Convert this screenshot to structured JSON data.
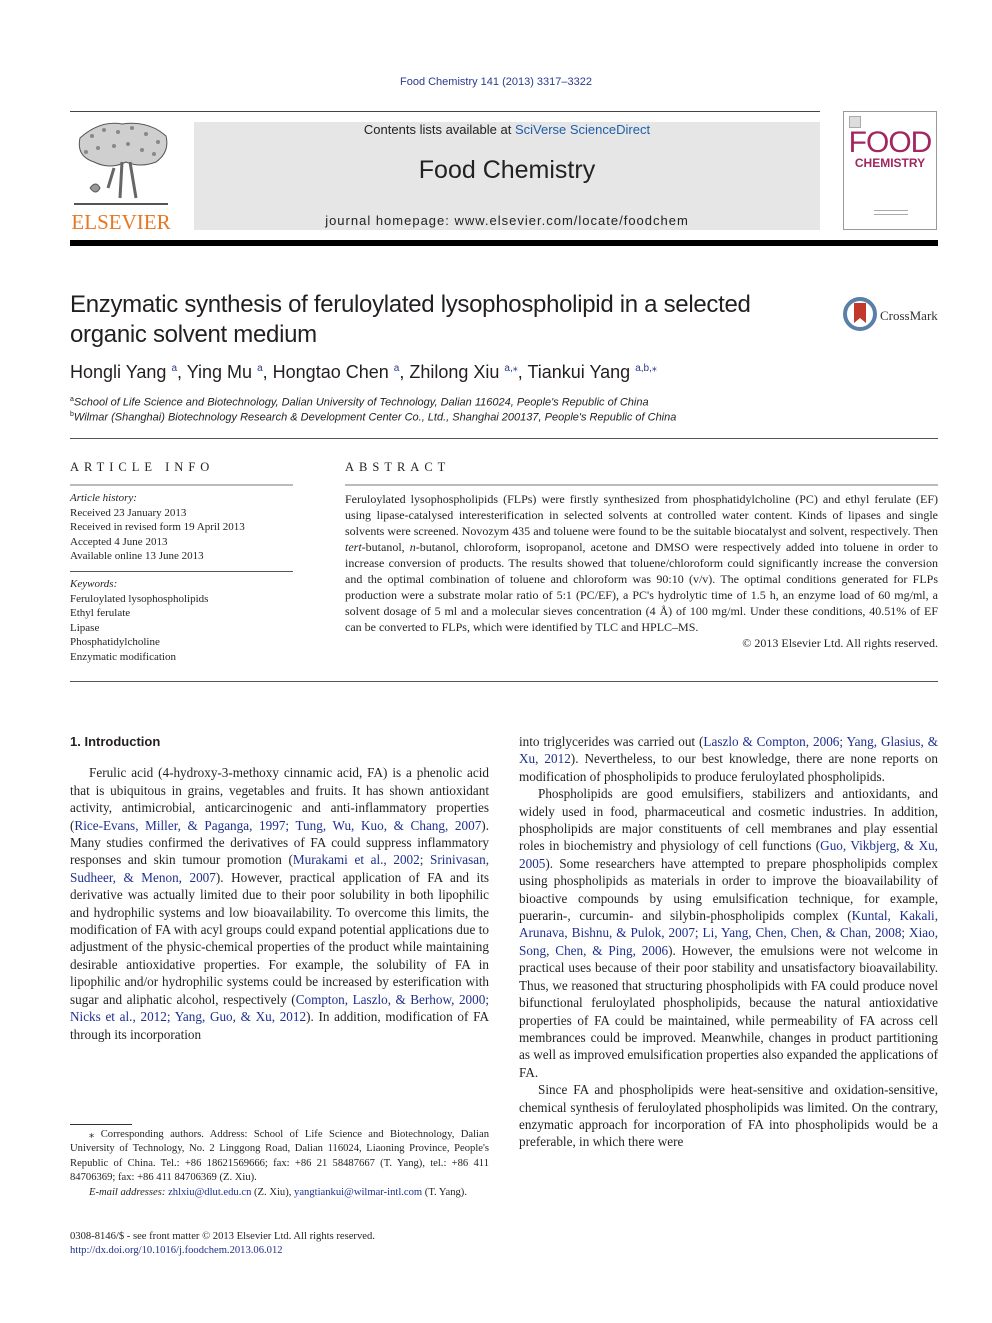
{
  "header": {
    "citation": "Food Chemistry 141 (2013) 3317–3322",
    "contents_prefix": "Contents lists available at ",
    "contents_link": "SciVerse ScienceDirect",
    "journal_name": "Food Chemistry",
    "homepage": "journal homepage: www.elsevier.com/locate/foodchem",
    "publisher_logo": "ELSEVIER",
    "cover": {
      "line1": "FOOD",
      "line2": "CHEMISTRY"
    },
    "colors": {
      "link": "#1e2f8f",
      "elsevier_orange": "#e87722",
      "cover_magenta": "#a0275f"
    }
  },
  "article": {
    "title": "Enzymatic synthesis of feruloylated lysophospholipid in a selected organic solvent medium",
    "crossmark_label": "CrossMark",
    "authors": [
      {
        "name": "Hongli Yang",
        "sup": "a"
      },
      {
        "name": "Ying Mu",
        "sup": "a"
      },
      {
        "name": "Hongtao Chen",
        "sup": "a"
      },
      {
        "name": "Zhilong Xiu",
        "sup": "a,⁎"
      },
      {
        "name": "Tiankui Yang",
        "sup": "a,b,⁎"
      }
    ],
    "affiliations": [
      {
        "sup": "a",
        "text": "School of Life Science and Biotechnology, Dalian University of Technology, Dalian 116024, People's Republic of China"
      },
      {
        "sup": "b",
        "text": "Wilmar (Shanghai) Biotechnology Research & Development Center Co., Ltd., Shanghai 200137, People's Republic of China"
      }
    ]
  },
  "article_info": {
    "heading": "ARTICLE INFO",
    "history_label": "Article history:",
    "history": [
      "Received 23 January 2013",
      "Received in revised form 19 April 2013",
      "Accepted 4 June 2013",
      "Available online 13 June 2013"
    ],
    "keywords_label": "Keywords:",
    "keywords": [
      "Feruloylated lysophospholipids",
      "Ethyl ferulate",
      "Lipase",
      "Phosphatidylcholine",
      "Enzymatic modification"
    ]
  },
  "abstract": {
    "heading": "ABSTRACT",
    "p1": "Feruloylated lysophospholipids (FLPs) were firstly synthesized from phosphatidylcholine (PC) and ethyl ferulate (EF) using lipase-catalysed interesterification in selected solvents at controlled water content. Kinds of lipases and single solvents were screened. Novozym 435 and toluene were found to be the suitable biocatalyst and solvent, respectively. Then ",
    "tert": "tert",
    "p2": "-butanol, ",
    "n": "n",
    "p3": "-butanol, chloroform, isopropanol, acetone and DMSO were respectively added into toluene in order to increase conversion of products. The results showed that toluene/chloroform could significantly increase the conversion and the optimal combination of toluene and chloroform was 90:10 (v/v). The optimal conditions generated for FLPs production were a substrate molar ratio of 5:1 (PC/EF), a PC's hydrolytic time of 1.5 h, an enzyme load of 60 mg/ml, a solvent dosage of 5 ml and a molecular sieves concentration (4 Å) of 100 mg/ml. Under these conditions, 40.51% of EF can be converted to FLPs, which were identified by TLC and HPLC–MS.",
    "copyright": "© 2013 Elsevier Ltd. All rights reserved."
  },
  "introduction": {
    "heading": "1. Introduction",
    "left": {
      "t1": "Ferulic acid (4-hydroxy-3-methoxy cinnamic acid, FA) is a phenolic acid that is ubiquitous in grains, vegetables and fruits. It has shown antioxidant activity, antimicrobial, anticarcinogenic and anti-inflammatory properties (",
      "r1": "Rice-Evans, Miller, & Paganga, 1997; Tung, Wu, Kuo, & Chang, 2007",
      "t2": "). Many studies confirmed the derivatives of FA could suppress inflammatory responses and skin tumour promotion (",
      "r2": "Murakami et al., 2002; Srinivasan, Sudheer, & Menon, 2007",
      "t3": "). However, practical application of FA and its derivative was actually limited due to their poor solubility in both lipophilic and hydrophilic systems and low bioavailability. To overcome this limits, the modification of FA with acyl groups could expand potential applications due to adjustment of the physic-chemical properties of the product while maintaining desirable antioxidative properties. For example, the solubility of FA in lipophilic and/or hydrophilic systems could be increased by esterification with sugar and aliphatic alcohol, respectively (",
      "r3": "Compton, Laszlo, & Berhow, 2000; Nicks et al., 2012; Yang, Guo, & Xu, 2012",
      "t4": "). In addition, modification of FA through its incorporation"
    },
    "right": {
      "t1": "into triglycerides was carried out (",
      "r1": "Laszlo & Compton, 2006; Yang, Glasius, & Xu, 2012",
      "t2": "). Nevertheless, to our best knowledge, there are none reports on modification of phospholipids to produce feruloylated phospholipids.",
      "p2_t1": "Phospholipids are good emulsifiers, stabilizers and antioxidants, and widely used in food, pharmaceutical and cosmetic industries. In addition, phospholipids are major constituents of cell membranes and play essential roles in biochemistry and physiology of cell functions (",
      "p2_r1": "Guo, Vikbjerg, & Xu, 2005",
      "p2_t2": "). Some researchers have attempted to prepare phospholipids complex using phospholipids as materials in order to improve the bioavailability of bioactive compounds by using emulsification technique, for example, puerarin-, curcumin- and silybin-phospholipids complex (",
      "p2_r2": "Kuntal, Kakali, Arunava, Bishnu, & Pulok, 2007; Li, Yang, Chen, Chen, & Chan, 2008; Xiao, Song, Chen, & Ping, 2006",
      "p2_t3": "). However, the emulsions were not welcome in practical uses because of their poor stability and unsatisfactory bioavailability. Thus, we reasoned that structuring phospholipids with FA could produce novel bifunctional feruloylated phospholipids, because the natural antioxidative properties of FA could be maintained, while permeability of FA across cell membrances could be improved. Meanwhile, changes in product partitioning as well as improved emulsification properties also expanded the applications of FA.",
      "p3": "Since FA and phospholipids were heat-sensitive and oxidation-sensitive, chemical synthesis of feruloylated phospholipids was limited. On the contrary, enzymatic approach for incorporation of FA into phospholipids would be a preferable, in which there were"
    }
  },
  "footnotes": {
    "corresponding": "⁎ Corresponding authors. Address: School of Life Science and Biotechnology, Dalian University of Technology, No. 2 Linggong Road, Dalian 116024, Liaoning Province, People's Republic of China. Tel.: +86 18621569666; fax: +86 21 58487667 (T. Yang), tel.: +86 411 84706369; fax: +86 411 84706369 (Z. Xiu).",
    "email_label": "E-mail addresses:",
    "email1": "zhlxiu@dlut.edu.cn",
    "email1_who": " (Z. Xiu), ",
    "email2": "yangtiankui@wilmar-intl.com",
    "email2_who": " (T. Yang).",
    "front_matter": "0308-8146/$ - see front matter © 2013 Elsevier Ltd. All rights reserved.",
    "doi": "http://dx.doi.org/10.1016/j.foodchem.2013.06.012"
  }
}
